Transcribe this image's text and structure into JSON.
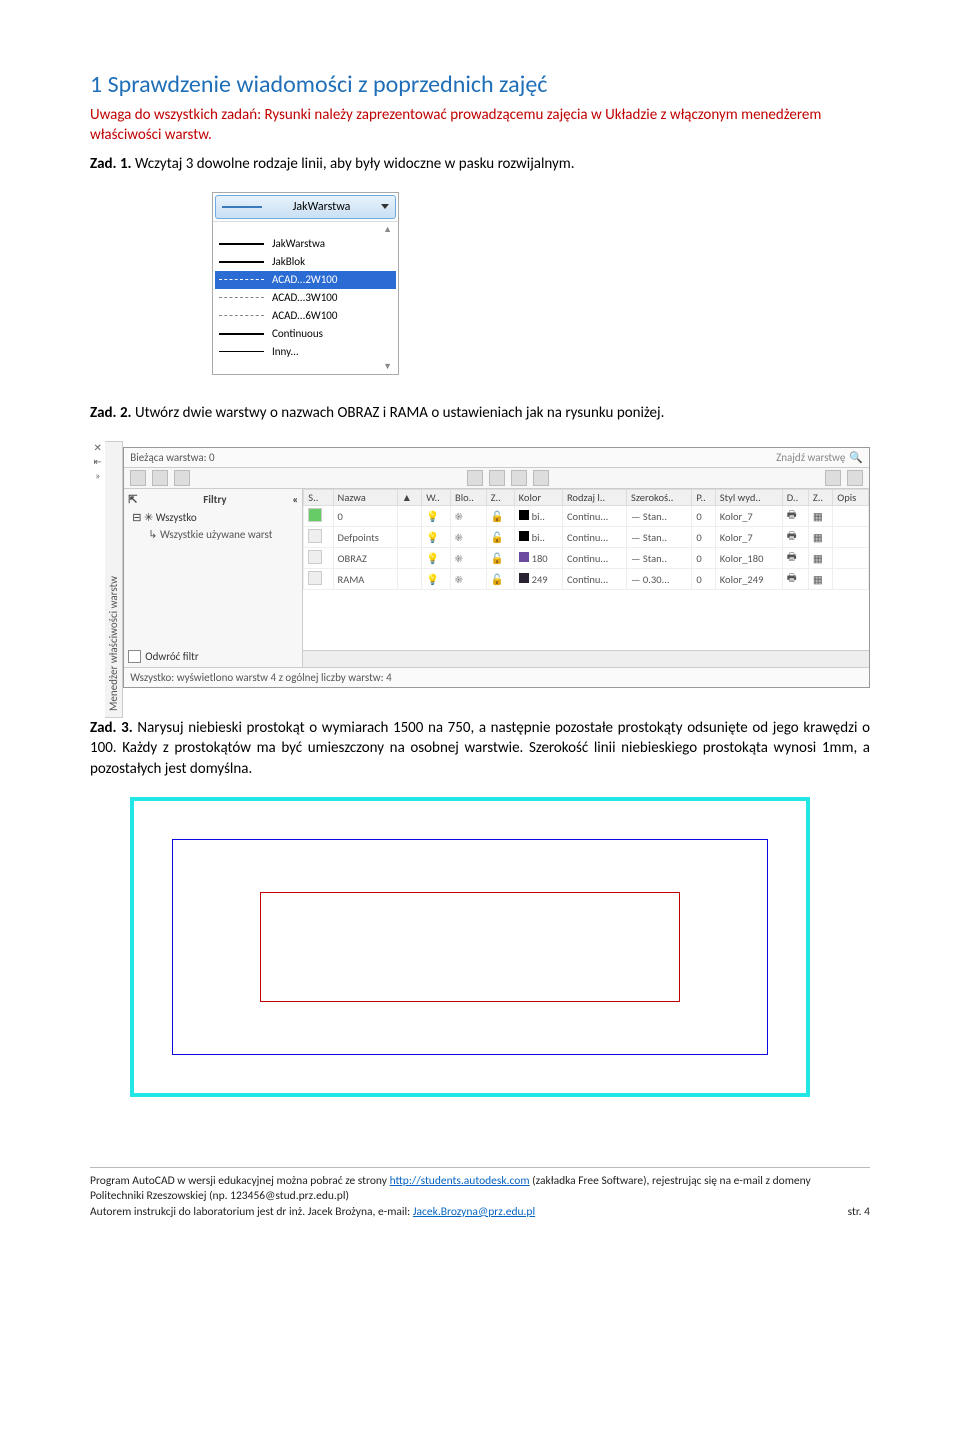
{
  "heading": "1   Sprawdzenie wiadomości z poprzednich zajęć",
  "intro": "Uwaga do wszystkich zadań: Rysunki należy zaprezentować prowadzącemu zajęcia w Układzie z włączonym menedżerem właściwości warstw.",
  "zad1_label": "Zad. 1.",
  "zad1_text": " Wczytaj 3 dowolne rodzaje linii, aby były widoczne w pasku rozwijalnym.",
  "dropdown": {
    "top": "JakWarstwa",
    "items": [
      "JakWarstwa",
      "JakBlok",
      "ACAD...2W100",
      "ACAD...3W100",
      "ACAD...6W100",
      "Continuous",
      "Inny..."
    ],
    "selectedIndex": 2
  },
  "zad2_label": "Zad. 2.",
  "zad2_text": " Utwórz dwie warstwy o nazwach OBRAZ i RAMA o ustawieniach jak na rysunku poniżej.",
  "lp": {
    "vtitle": "Menedżer właściwości warstw",
    "topLabel": "Bieżąca warstwa: 0",
    "search": "Znajdź warstwę",
    "filters": "Filtry",
    "tree_all": "Wszystko",
    "tree_used": "Wszystkie używane warst",
    "odwroc": "Odwróć filtr",
    "cols": [
      "S..",
      "Nazwa",
      "W..",
      "Blo..",
      "Z..",
      "Kolor",
      "Rodzaj l..",
      "Szerokoś..",
      "P..",
      "Styl wyd..",
      "D..",
      "Z..",
      "Opis"
    ],
    "rows": [
      {
        "name": "0",
        "col": "bi..",
        "colHex": "#000",
        "lt": "Continu...",
        "lw": "—",
        "lws": "Stan..",
        "tr": "0",
        "ps": "Kolor_7"
      },
      {
        "name": "Defpoints",
        "col": "bi..",
        "colHex": "#000",
        "lt": "Continu...",
        "lw": "—",
        "lws": "Stan..",
        "tr": "0",
        "ps": "Kolor_7"
      },
      {
        "name": "OBRAZ",
        "col": "180",
        "colHex": "#6b4aa0",
        "lt": "Continu...",
        "lw": "—",
        "lws": "Stan..",
        "tr": "0",
        "ps": "Kolor_180"
      },
      {
        "name": "RAMA",
        "col": "249",
        "colHex": "#2a2230",
        "lt": "Continu...",
        "lw": "—",
        "lws": "0.30...",
        "tr": "0",
        "ps": "Kolor_249"
      }
    ],
    "status": "Wszystko: wyświetlono warstw 4 z ogólnej liczby warstw: 4"
  },
  "zad3_label": "Zad. 3.",
  "zad3_text": " Narysuj niebieski prostokąt o wymiarach 1500 na 750, a następnie pozostałe prostokąty odsunięte od jego krawędzi o 100. Każdy z prostokątów ma być umieszczony na osobnej warstwie. Szerokość linii niebieskiego prostokąta wynosi 1mm, a pozostałych jest domyślna.",
  "footer": {
    "l1a": "Program AutoCAD w wersji edukacyjnej można pobrać ze strony ",
    "l1link": "http://students.autodesk.com",
    "l1b": " (zakładka Free Software), rejestrując się na e-mail z domeny Politechniki Rzeszowskiej (np. 123456@stud.prz.edu.pl)",
    "l2a": "Autorem instrukcji do laboratorium jest dr inż. Jacek Brożyna, e-mail: ",
    "l2link": "Jacek.Brozyna@prz.edu.pl",
    "page": "str. 4"
  }
}
